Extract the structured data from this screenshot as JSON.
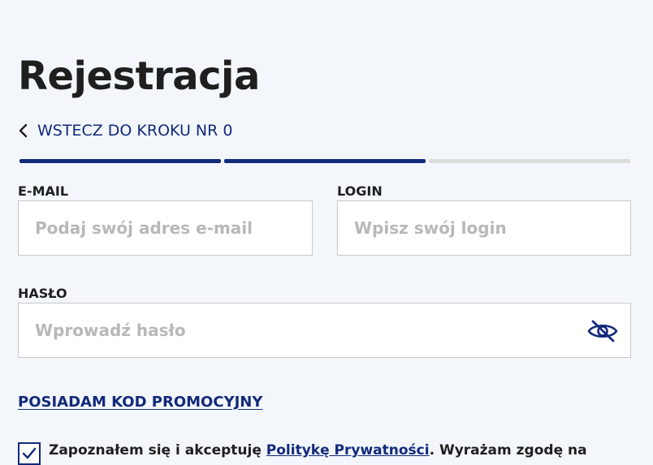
{
  "page": {
    "title": "Rejestracja",
    "back_link": "WSTECZ DO KROKU NR 0",
    "progress": {
      "total_steps": 3,
      "active_steps": 2
    }
  },
  "form": {
    "email": {
      "label": "E-MAIL",
      "placeholder": "Podaj swój adres e-mail",
      "value": ""
    },
    "login": {
      "label": "LOGIN",
      "placeholder": "Wpisz swój login",
      "value": ""
    },
    "password": {
      "label": "HASŁO",
      "placeholder": "Wprowadź hasło",
      "value": "",
      "toggle_icon": "eye-slash-icon"
    },
    "promo_link": "POSIADAM KOD PROMOCYJNY",
    "consent": {
      "checked": true,
      "text_before": "Zapoznałem się i akceptuję ",
      "policy_link": "Politykę Prywatności",
      "text_after": ". Wyrażam zgodę na"
    }
  },
  "colors": {
    "background": "#f3f7fc",
    "accent": "#132a7a",
    "border": "#c9c9c9",
    "placeholder": "#b8b8b8",
    "inactive_progress": "#dcdcdc"
  }
}
